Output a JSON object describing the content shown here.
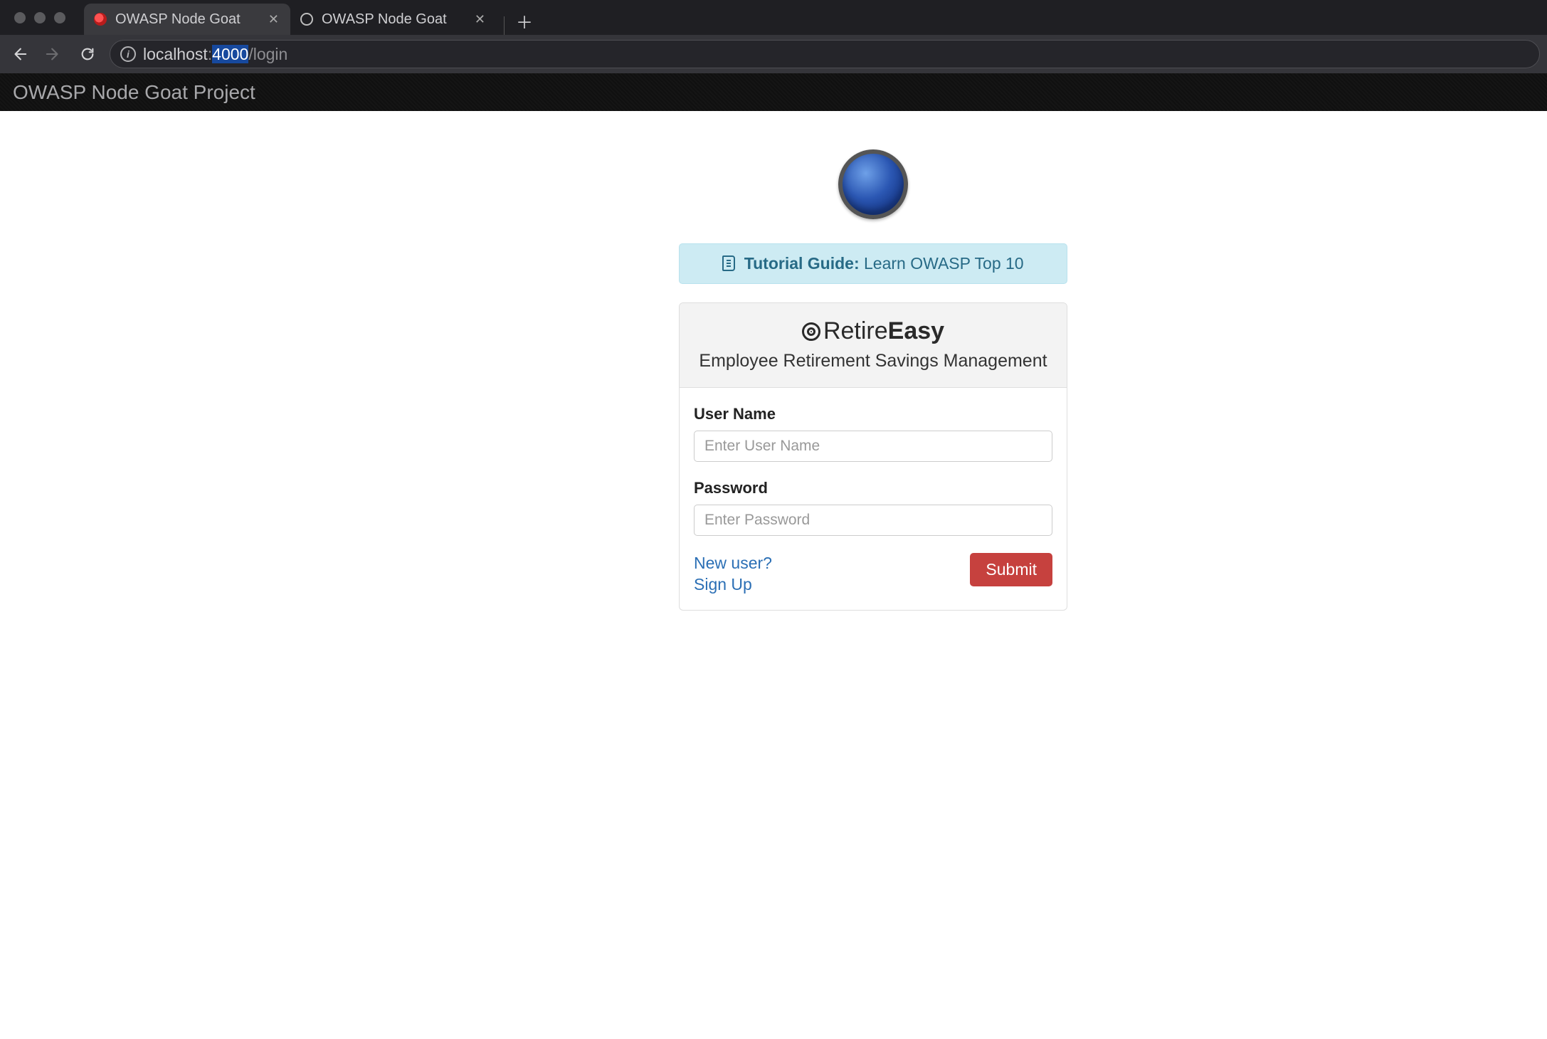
{
  "browser": {
    "tabs": [
      {
        "title": "OWASP Node Goat",
        "active": true
      },
      {
        "title": "OWASP Node Goat",
        "active": false
      }
    ],
    "url": {
      "host": "localhost",
      "sep": ":",
      "port": "4000",
      "path": "/login"
    }
  },
  "appHeader": {
    "title": "OWASP Node Goat Project"
  },
  "alert": {
    "strong": "Tutorial Guide:",
    "text": "Learn OWASP Top 10"
  },
  "panel": {
    "brand_a": "Retire",
    "brand_b": "Easy",
    "subtitle": "Employee Retirement Savings Management"
  },
  "form": {
    "username_label": "User Name",
    "username_placeholder": "Enter User Name",
    "password_label": "Password",
    "password_placeholder": "Enter Password",
    "signup_text": "New user? Sign Up",
    "submit_label": "Submit"
  }
}
